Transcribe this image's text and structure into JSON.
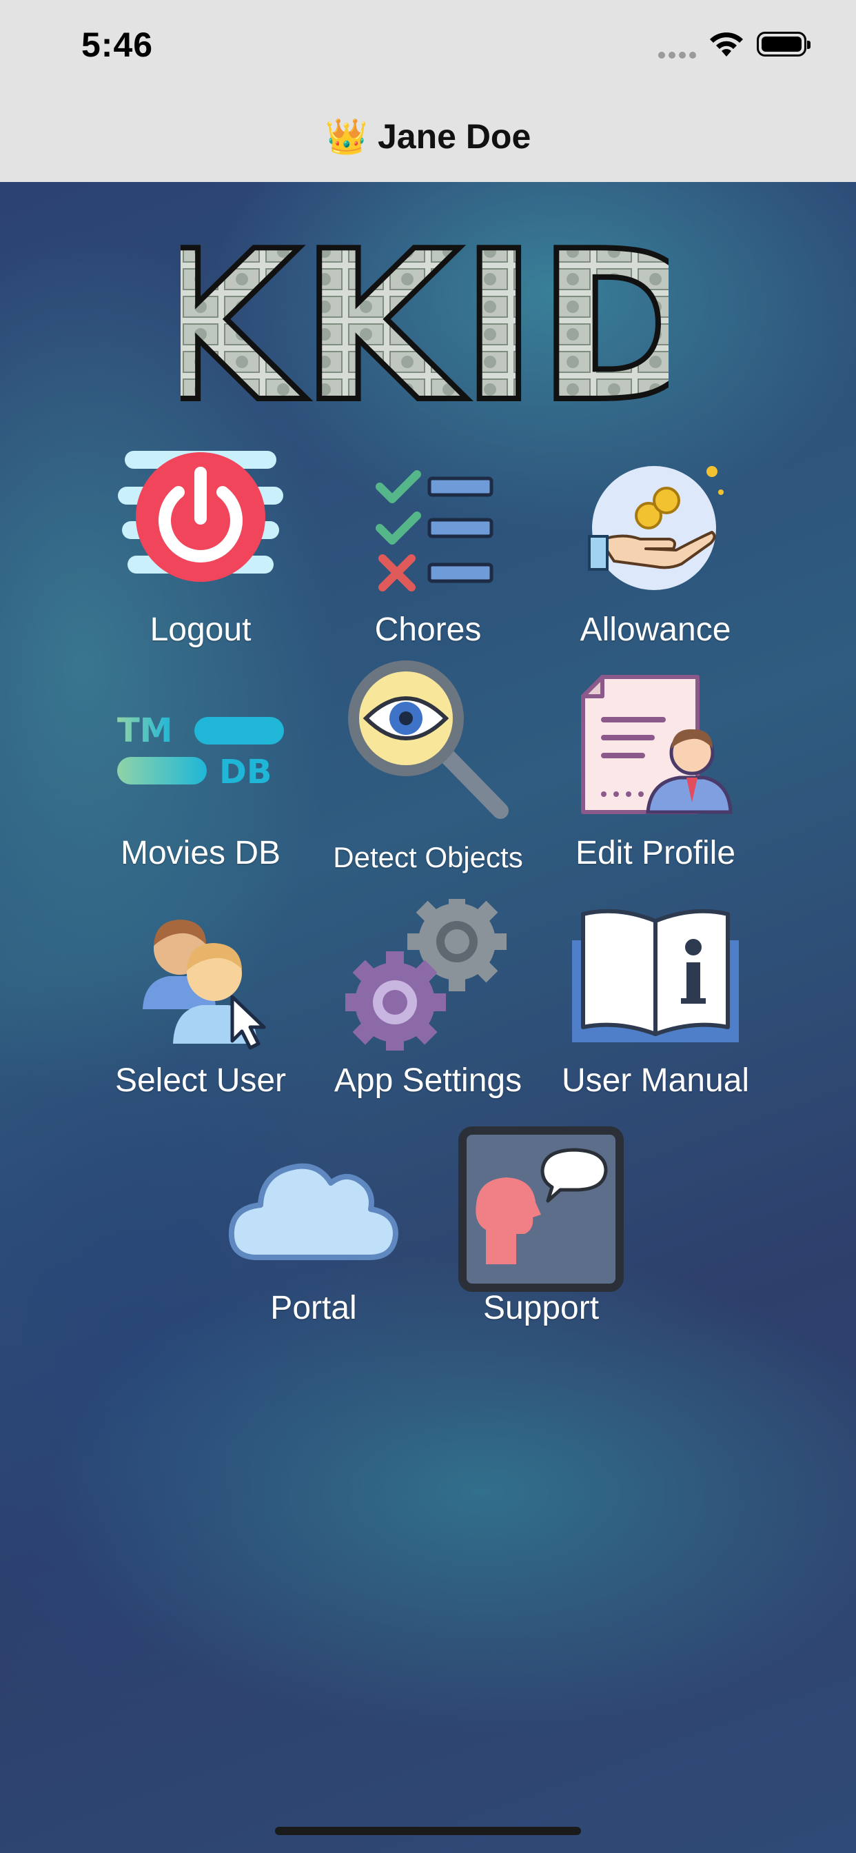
{
  "status": {
    "time": "5:46"
  },
  "nav": {
    "crown_icon": "👑",
    "title": "Jane Doe"
  },
  "logo": {
    "text": "KKID"
  },
  "menu": {
    "logout": "Logout",
    "chores": "Chores",
    "allowance": "Allowance",
    "movies_db": "Movies DB",
    "detect_objects": "Detect Objects",
    "edit_profile": "Edit Profile",
    "select_user": "Select User",
    "app_settings": "App Settings",
    "user_manual": "User Manual",
    "portal": "Portal",
    "support": "Support"
  },
  "tmdb_logo": {
    "top": "TM",
    "bottom": "DB"
  },
  "colors": {
    "nav_background": "#e3e3e3",
    "logout_red": "#f0455b",
    "tmdb_teal": "#1fb6d8",
    "tmdb_green": "#8fd3a8"
  }
}
